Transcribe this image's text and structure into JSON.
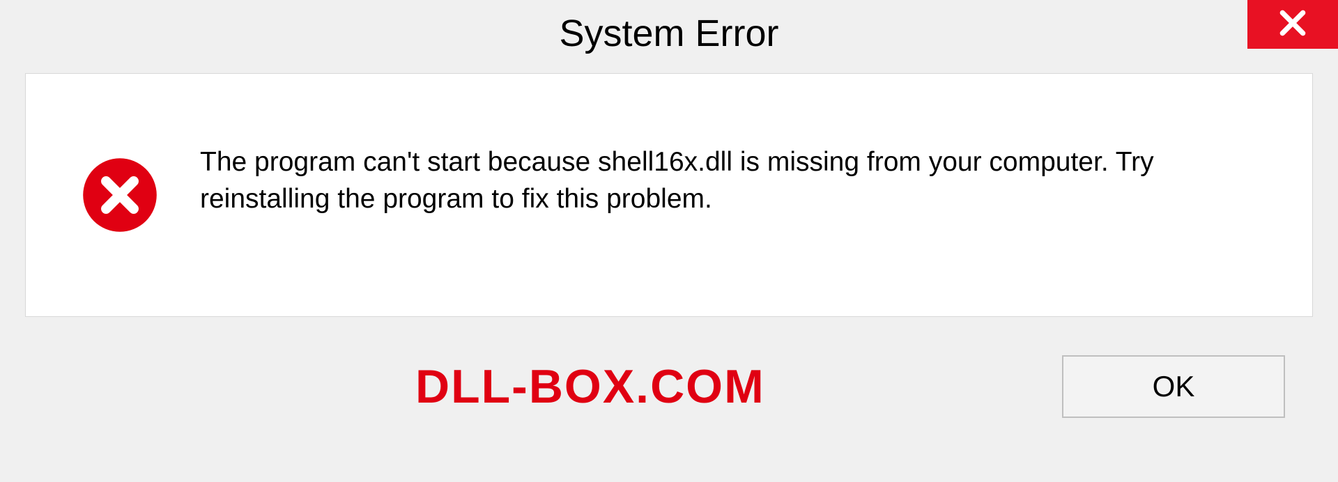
{
  "dialog": {
    "title": "System Error",
    "message": "The program can't start because shell16x.dll is missing from your computer. Try reinstalling the program to fix this problem.",
    "ok_label": "OK"
  },
  "watermark": "DLL-BOX.COM",
  "colors": {
    "close_bg": "#e81123",
    "error_red": "#e00012"
  }
}
